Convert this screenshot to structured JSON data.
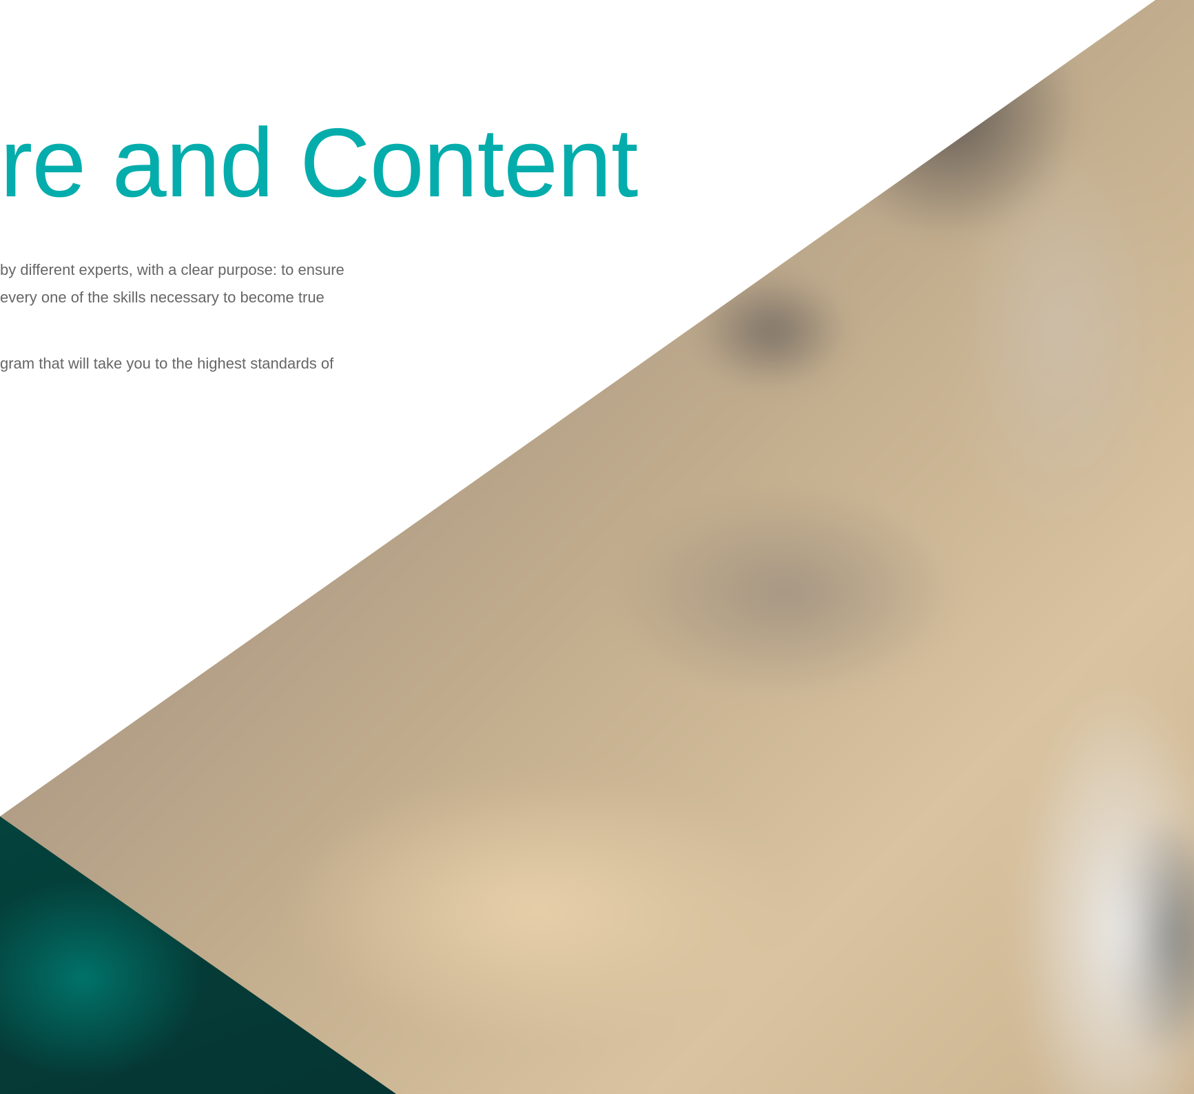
{
  "hero": {
    "title": "re and Content",
    "paragraph1": {
      "line1": "by different experts, with a clear purpose: to ensure",
      "line2": "every one of the skills necessary to become true"
    },
    "paragraph2": {
      "line1": "gram that will take you to the highest standards of"
    }
  },
  "colors": {
    "title": "#04adab",
    "body_text": "#666666",
    "teal_accent": "#035f55",
    "background": "#ffffff"
  }
}
